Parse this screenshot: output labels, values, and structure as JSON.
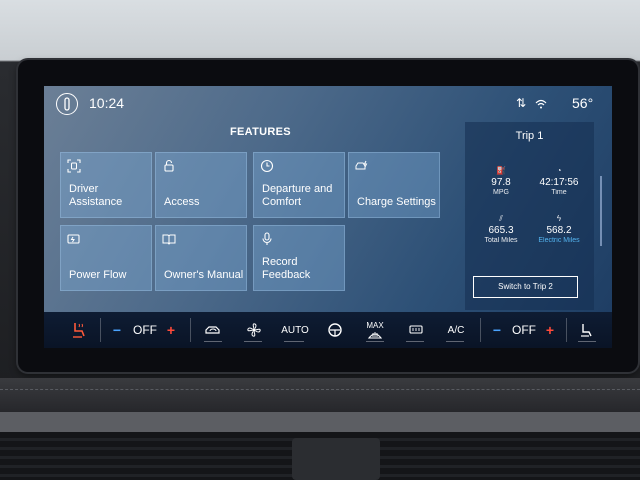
{
  "status_bar": {
    "time": "10:24",
    "temperature": "56°"
  },
  "features": {
    "title": "FEATURES",
    "tiles": [
      {
        "label": "Driver Assistance",
        "icon": "driver-assist-icon"
      },
      {
        "label": "Access",
        "icon": "lock-icon"
      },
      {
        "label": "Departure and Comfort",
        "icon": "clock-icon"
      },
      {
        "label": "Charge Settings",
        "icon": "charge-icon"
      },
      {
        "label": "Power Flow",
        "icon": "battery-icon"
      },
      {
        "label": "Owner's Manual",
        "icon": "book-icon"
      },
      {
        "label": "Record Feedback",
        "icon": "microphone-icon"
      }
    ]
  },
  "trip": {
    "title": "Trip 1",
    "stats": [
      {
        "value": "97.8",
        "label": "MPG",
        "icon": "fuel-icon"
      },
      {
        "value": "42:17:56",
        "label": "Time",
        "icon": "timer-icon"
      },
      {
        "value": "665.3",
        "label": "Total Miles",
        "icon": "road-icon"
      },
      {
        "value": "568.2",
        "label": "Electric Miles",
        "icon": "electric-road-icon",
        "accent": "#59c1ff"
      }
    ],
    "switch_label": "Switch to Trip 2"
  },
  "climate": {
    "left_temp": "OFF",
    "right_temp": "OFF",
    "auto_label": "AUTO",
    "max_label": "MAX",
    "ac_label": "A/C",
    "minus": "−",
    "plus": "+"
  },
  "colors": {
    "plus": "#ff4a3a",
    "minus": "#4aa3ff",
    "seat_heat": "#ff5a3a"
  }
}
